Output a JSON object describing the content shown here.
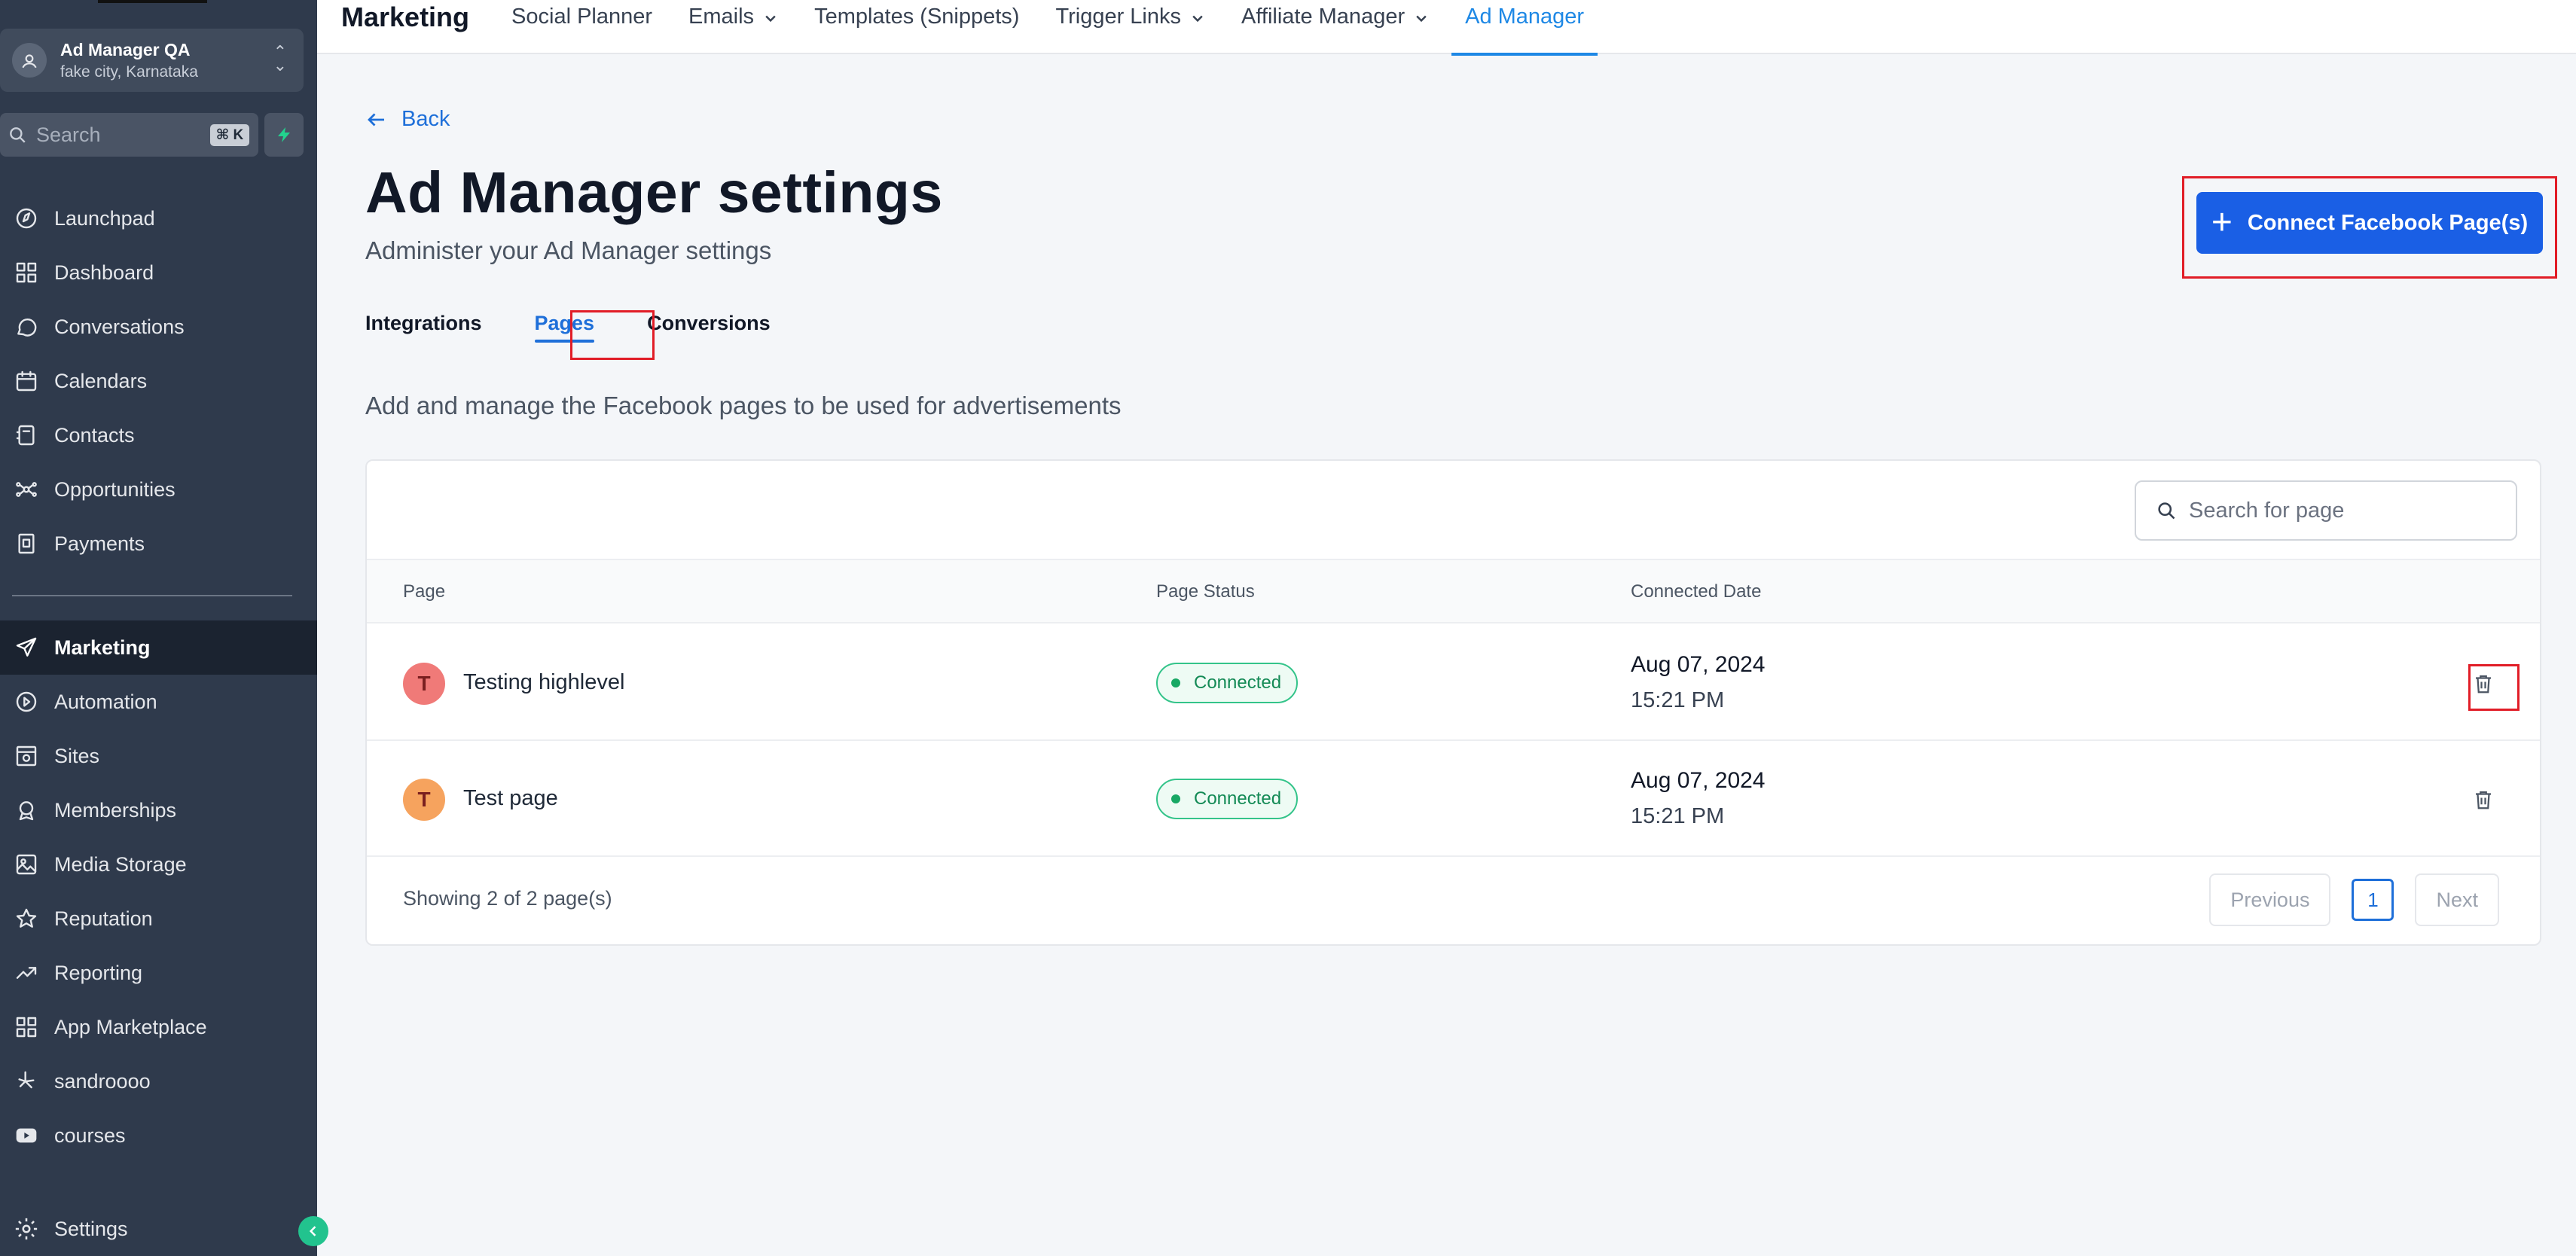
{
  "sidebar": {
    "account": {
      "name": "Ad Manager QA",
      "location": "fake city, Karnataka"
    },
    "search": {
      "placeholder": "Search",
      "shortcut": "⌘ K"
    },
    "items": [
      {
        "label": "Launchpad",
        "icon": "launchpad-icon"
      },
      {
        "label": "Dashboard",
        "icon": "dashboard-icon"
      },
      {
        "label": "Conversations",
        "icon": "chat-bubble-icon"
      },
      {
        "label": "Calendars",
        "icon": "calendar-icon"
      },
      {
        "label": "Contacts",
        "icon": "contacts-icon"
      },
      {
        "label": "Opportunities",
        "icon": "opportunities-icon"
      },
      {
        "label": "Payments",
        "icon": "payments-icon"
      },
      {
        "label": "Marketing",
        "icon": "send-icon",
        "active": true
      },
      {
        "label": "Automation",
        "icon": "automation-icon"
      },
      {
        "label": "Sites",
        "icon": "sites-icon"
      },
      {
        "label": "Memberships",
        "icon": "memberships-icon"
      },
      {
        "label": "Media Storage",
        "icon": "image-icon"
      },
      {
        "label": "Reputation",
        "icon": "star-icon"
      },
      {
        "label": "Reporting",
        "icon": "trend-icon"
      },
      {
        "label": "App Marketplace",
        "icon": "grid-icon"
      },
      {
        "label": "sandroooo",
        "icon": "yelp-icon"
      },
      {
        "label": "courses",
        "icon": "youtube-icon"
      }
    ],
    "settings": {
      "label": "Settings",
      "icon": "gear-icon"
    }
  },
  "topnav": {
    "title": "Marketing",
    "links": [
      {
        "label": "Social Planner",
        "dropdown": false
      },
      {
        "label": "Emails",
        "dropdown": true
      },
      {
        "label": "Templates (Snippets)",
        "dropdown": false
      },
      {
        "label": "Trigger Links",
        "dropdown": true
      },
      {
        "label": "Affiliate Manager",
        "dropdown": true
      },
      {
        "label": "Ad Manager",
        "dropdown": false,
        "active": true
      }
    ]
  },
  "main": {
    "back": "Back",
    "title": "Ad Manager settings",
    "subtitle": "Administer your Ad Manager settings",
    "connect_button": "Connect Facebook Page(s)",
    "tabs": [
      {
        "label": "Integrations"
      },
      {
        "label": "Pages",
        "active": true
      },
      {
        "label": "Conversions"
      }
    ],
    "description": "Add and manage the Facebook pages to be used for advertisements",
    "table": {
      "search_placeholder": "Search for page",
      "headers": {
        "page": "Page",
        "status": "Page Status",
        "date": "Connected Date"
      },
      "rows": [
        {
          "initial": "T",
          "avatar_color": "#f07a78",
          "name": "Testing highlevel",
          "status": "Connected",
          "date": "Aug 07, 2024",
          "time": "15:21 PM"
        },
        {
          "initial": "T",
          "avatar_color": "#f6a35e",
          "name": "Test page",
          "status": "Connected",
          "date": "Aug 07, 2024",
          "time": "15:21 PM"
        }
      ],
      "showing": "Showing 2 of 2 page(s)",
      "pager": {
        "previous": "Previous",
        "page": "1",
        "next": "Next"
      }
    }
  },
  "colors": {
    "accent": "#1a5fe5",
    "link": "#1e6fd9",
    "sidebar": "#2f3a4c",
    "success": "#18a864",
    "highlight": "#e11d27"
  }
}
